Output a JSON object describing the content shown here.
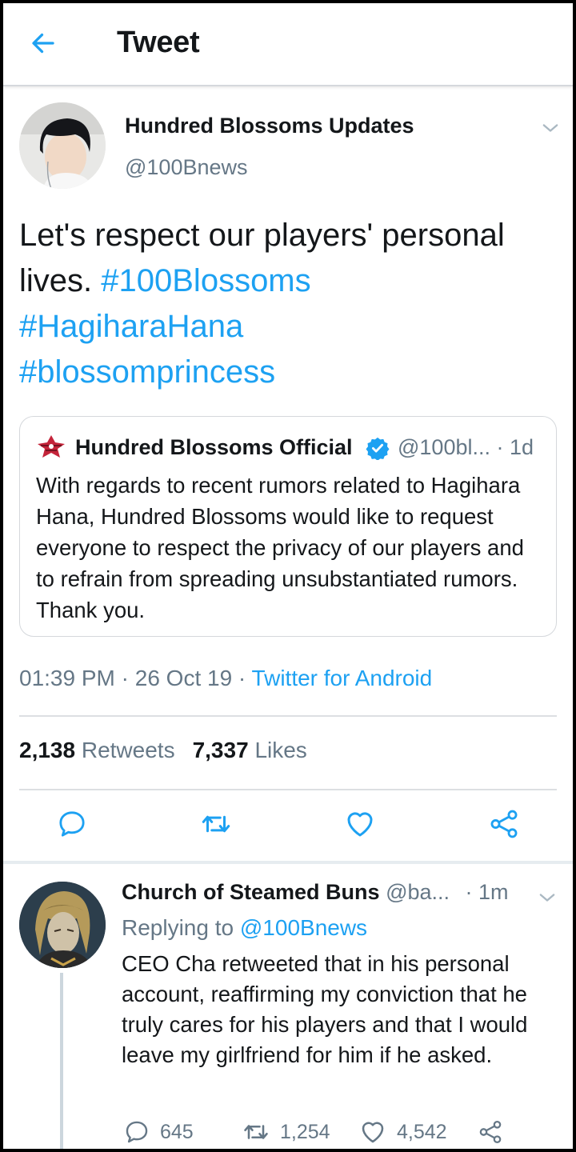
{
  "header": {
    "title": "Tweet",
    "back_icon": "arrow-left-icon"
  },
  "tweet": {
    "author_name": "Hundred Blossoms Updates",
    "author_handle": "@100Bnews",
    "text_plain": "Let's respect our players' personal lives.",
    "hashtags": [
      "#100Blossoms",
      "#HagiharaHana",
      "#blossomprincess"
    ],
    "quote": {
      "author_name": "Hundred Blossoms Official",
      "verified": true,
      "handle_time": "@100bl... · 1d",
      "text": "With regards to recent rumors related to Hagihara Hana, Hundred Blossoms would like to request everyone to respect the privacy of our players and to refrain from spreading unsubstantiated rumors. Thank you."
    },
    "time": "01:39 PM",
    "date": "26 Oct 19",
    "source": "Twitter for Android",
    "retweets_count": "2,138",
    "retweets_label": "Retweets",
    "likes_count": "7,337",
    "likes_label": "Likes"
  },
  "reply": {
    "author_name": "Church of Steamed Buns",
    "handle": "@ba...",
    "time": "· 1m",
    "replying_label": "Replying to",
    "replying_to": "@100Bnews",
    "text": "CEO Cha retweeted that in his personal account, reaffirming my conviction that he truly cares for his players and that I would leave my girlfriend for him if he asked.",
    "reply_count": "645",
    "retweet_count": "1,254",
    "like_count": "4,542"
  },
  "colors": {
    "accent": "#1da1f2",
    "text": "#14171a",
    "muted": "#657786",
    "divider": "#dcdfe2"
  }
}
